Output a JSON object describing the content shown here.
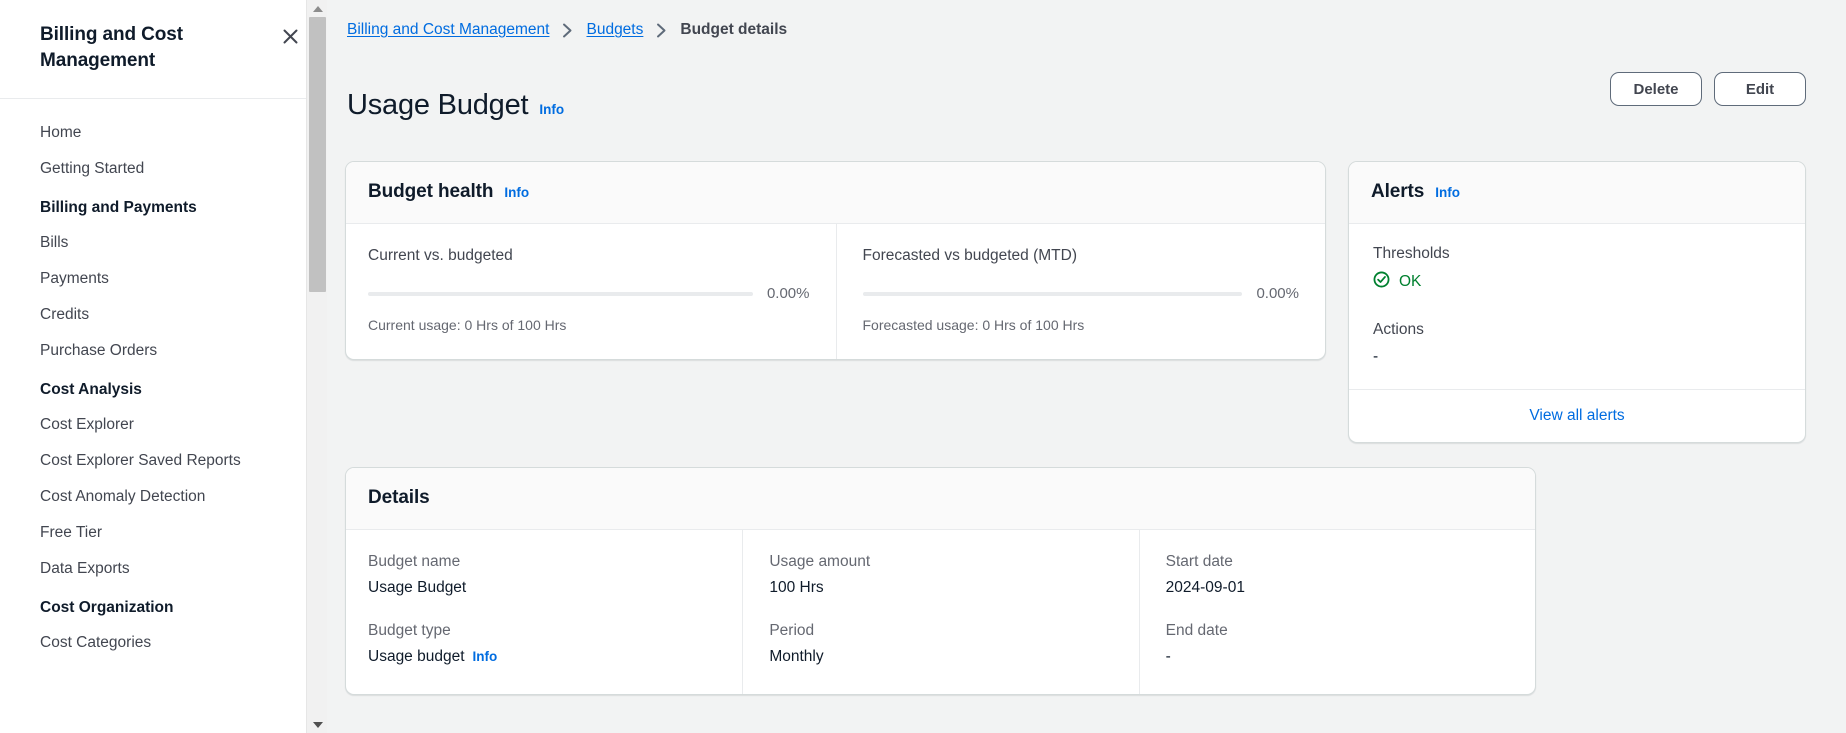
{
  "sidebar": {
    "title": "Billing and Cost Management",
    "close_icon": "close-icon",
    "items": [
      {
        "label": "Home",
        "type": "link"
      },
      {
        "label": "Getting Started",
        "type": "link"
      },
      {
        "label": "Billing and Payments",
        "type": "section"
      },
      {
        "label": "Bills",
        "type": "link"
      },
      {
        "label": "Payments",
        "type": "link"
      },
      {
        "label": "Credits",
        "type": "link"
      },
      {
        "label": "Purchase Orders",
        "type": "link"
      },
      {
        "label": "Cost Analysis",
        "type": "section"
      },
      {
        "label": "Cost Explorer",
        "type": "link"
      },
      {
        "label": "Cost Explorer Saved Reports",
        "type": "link"
      },
      {
        "label": "Cost Anomaly Detection",
        "type": "link"
      },
      {
        "label": "Free Tier",
        "type": "link"
      },
      {
        "label": "Data Exports",
        "type": "link"
      },
      {
        "label": "Cost Organization",
        "type": "section"
      },
      {
        "label": "Cost Categories",
        "type": "link"
      }
    ]
  },
  "breadcrumb": {
    "item1": "Billing and Cost Management",
    "item2": "Budgets",
    "current": "Budget details"
  },
  "header": {
    "title": "Usage Budget",
    "info_label": "Info",
    "delete_label": "Delete",
    "edit_label": "Edit"
  },
  "budget_health": {
    "title": "Budget health",
    "info_label": "Info",
    "metrics": [
      {
        "label": "Current vs. budgeted",
        "percent_label": "0.00%",
        "percent_value": 0,
        "sub": "Current usage: 0 Hrs of 100 Hrs"
      },
      {
        "label": "Forecasted vs budgeted (MTD)",
        "percent_label": "0.00%",
        "percent_value": 0,
        "sub": "Forecasted usage: 0 Hrs of 100 Hrs"
      }
    ]
  },
  "alerts": {
    "title": "Alerts",
    "info_label": "Info",
    "thresholds_label": "Thresholds",
    "thresholds_status": "OK",
    "status_icon": "check-circle-icon",
    "status_color": "#00802f",
    "actions_label": "Actions",
    "actions_value": "-",
    "footer_link": "View all alerts"
  },
  "details": {
    "title": "Details",
    "columns": [
      {
        "fields": [
          {
            "key": "Budget name",
            "value": "Usage Budget",
            "info": null
          },
          {
            "key": "Budget type",
            "value": "Usage budget",
            "info": "Info"
          }
        ]
      },
      {
        "fields": [
          {
            "key": "Usage amount",
            "value": "100 Hrs",
            "info": null
          },
          {
            "key": "Period",
            "value": "Monthly",
            "info": null
          }
        ]
      },
      {
        "fields": [
          {
            "key": "Start date",
            "value": "2024-09-01",
            "info": null
          },
          {
            "key": "End date",
            "value": "-",
            "info": null
          }
        ]
      }
    ]
  },
  "colors": {
    "accent_link": "#006ce0",
    "success": "#00802f",
    "page_bg": "#f2f3f3",
    "card_bg": "#ffffff",
    "card_header_bg": "#fafafa",
    "border": "#d5dbdb"
  }
}
